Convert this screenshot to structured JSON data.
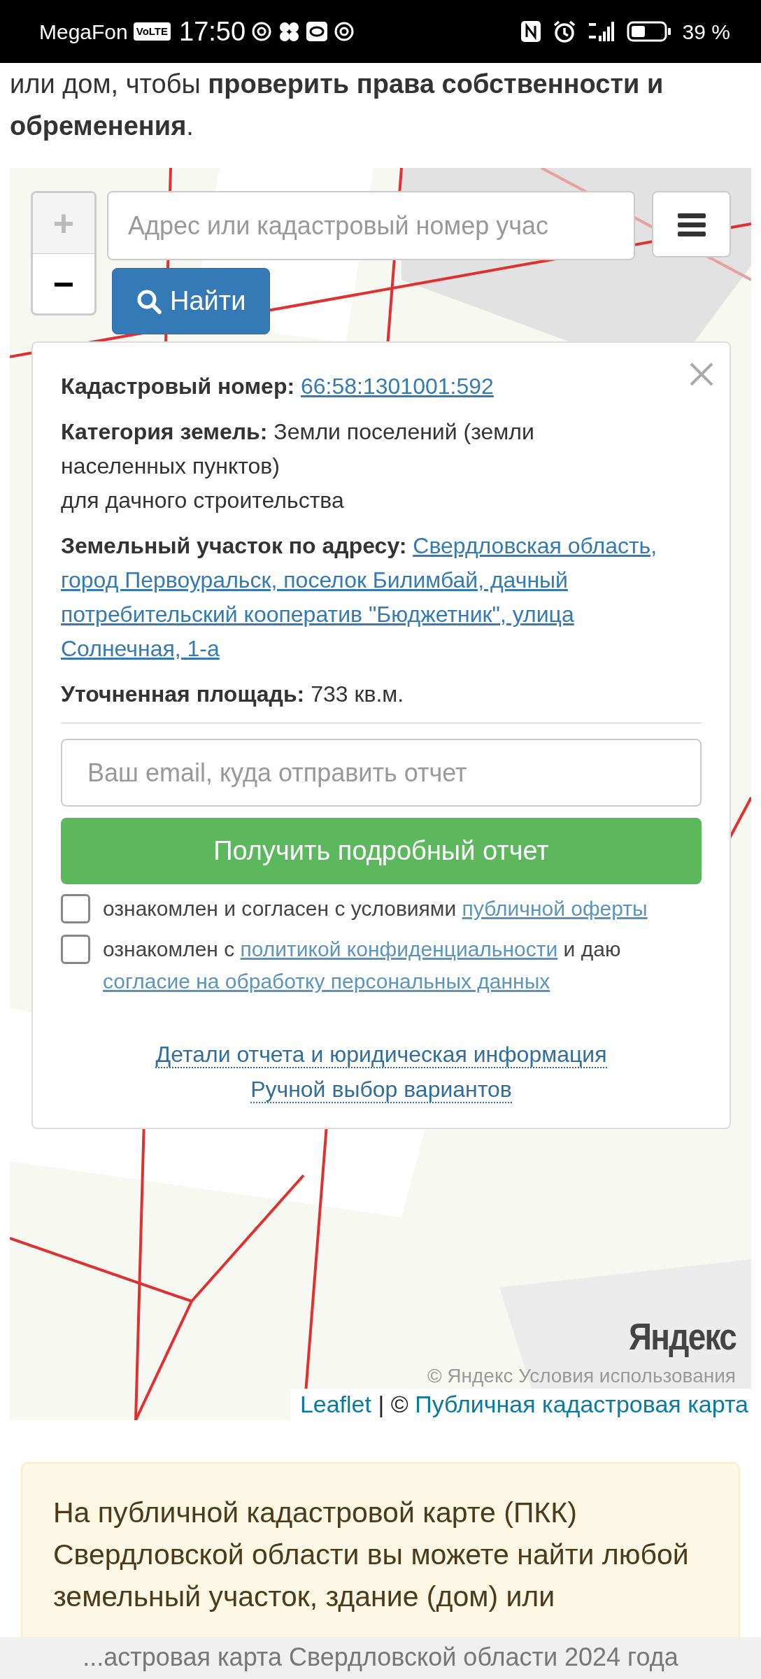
{
  "status_bar": {
    "carrier": "MegaFon",
    "volte": "VoLTE",
    "time": "17:50",
    "battery": "39 %"
  },
  "intro": "или дом, чтобы **проверить права собственности и обременения**.",
  "map": {
    "zoom_in": {
      "label": "+",
      "disabled": true
    },
    "zoom_out": {
      "label": "−",
      "disabled": false
    },
    "search": {
      "placeholder": "Адрес или кадастровый номер учас"
    },
    "find_button": "Найти",
    "popup": {
      "fields": [
        {
          "label": "Кадастровый номер:",
          "kind": "link",
          "values": [
            "66:58:1301001:592"
          ]
        },
        {
          "label": "Категория земель:",
          "kind": "text",
          "values": [
            "Земли поселений (земли",
            "населенных пунктов)",
            "для дачного строительства"
          ]
        },
        {
          "label": "Земельный участок по адресу:",
          "kind": "link",
          "values": [
            "Свердловская область,",
            "город Первоуральск, поселок Билимбай, дачный",
            "потребительский кооператив \"Бюджетник\", улица",
            "Солнечная, 1-а"
          ]
        },
        {
          "label": "Уточненная площадь:",
          "kind": "text",
          "values": [
            "733 кв.м."
          ]
        }
      ],
      "email": {
        "placeholder": "Ваш email, куда отправить отчет"
      },
      "report_button": "Получить подробный отчет",
      "consents": [
        {
          "checked": false,
          "parts": [
            {
              "text": "ознакомлен и согласен с условиями",
              "kind": "text"
            },
            {
              "text": "публичной оферты",
              "kind": "link"
            }
          ]
        },
        {
          "checked": false,
          "parts": [
            {
              "text": "ознакомлен с",
              "kind": "text"
            },
            {
              "text": "политикой конфиденциальности",
              "kind": "link"
            },
            {
              "text": "и даю",
              "kind": "text"
            },
            {
              "text": "согласие на обработку персональных данных",
              "kind": "link"
            }
          ]
        }
      ],
      "footer_links": [
        "Детали отчета и юридическая информация",
        "Ручной выбор вариантов"
      ]
    },
    "yandex_logo": "Яндекс",
    "yandex_terms": "© Яндекс  Условия использования",
    "attribution": {
      "leaflet": "Leaflet",
      "separator": "| ©",
      "source": "Публичная кадастровая карта"
    }
  },
  "info_lines": [
    "На публичной кадастровой карте (ПКК) Свердловской области вы можете найти любой земельный участок, здание (дом) или"
  ],
  "bottom_bar": "...астровая карта Свердловской области 2024 года"
}
